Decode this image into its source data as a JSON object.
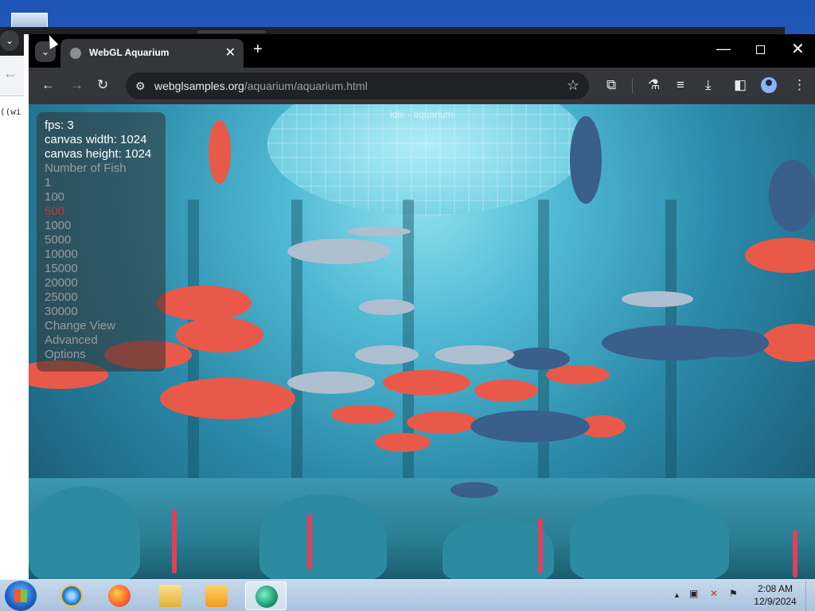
{
  "bg_window": {
    "tab_dropdown_glyph": "⌄",
    "back_glyph": "←",
    "code_text": "((wi"
  },
  "browser": {
    "tab_title": "WebGL Aquarium",
    "tab_close_glyph": "✕",
    "new_tab_glyph": "+",
    "tab_search_glyph": "⌄",
    "url_host": "webglsamples.org",
    "url_path": "/aquarium/aquarium.html",
    "window_controls": {
      "minimize": "—",
      "close": "✕"
    },
    "toolbar_glyphs": {
      "back": "←",
      "forward": "→",
      "reload": "↻",
      "site_info": "⚙",
      "bookmark": "☆",
      "extensions": "⧉",
      "labs": "⚗",
      "reading": "≡",
      "download": "⤓",
      "sidepanel": "◧",
      "menu": "⋮"
    }
  },
  "page": {
    "title": "idle - aquarium",
    "hud": {
      "fps": "fps: 3",
      "canvas_width": "canvas width: 1024",
      "canvas_height": "canvas height: 1024",
      "fish_label": "Number of Fish",
      "fish_options": [
        {
          "label": "1",
          "selected": false
        },
        {
          "label": "100",
          "selected": false
        },
        {
          "label": "500",
          "selected": true
        },
        {
          "label": "1000",
          "selected": false
        },
        {
          "label": "5000",
          "selected": false
        },
        {
          "label": "10000",
          "selected": false
        },
        {
          "label": "15000",
          "selected": false
        },
        {
          "label": "20000",
          "selected": false
        },
        {
          "label": "25000",
          "selected": false
        },
        {
          "label": "30000",
          "selected": false
        }
      ],
      "change_view": "Change View",
      "advanced": "Advanced",
      "options": "Options"
    }
  },
  "taskbar": {
    "apps": [
      "start-button",
      "internet-explorer",
      "firefox",
      "file-explorer",
      "media-player",
      "active-app"
    ],
    "clock_time": "2:08 AM",
    "clock_date": "12/9/2024",
    "tray_glyphs": {
      "overflow": "▲",
      "network": "▣",
      "volume": "✕",
      "flag": "⚑"
    }
  },
  "colors": {
    "chrome_dark": "#202124",
    "chrome_toolbar": "#35363a",
    "selected_fish_option": "#e03030"
  }
}
